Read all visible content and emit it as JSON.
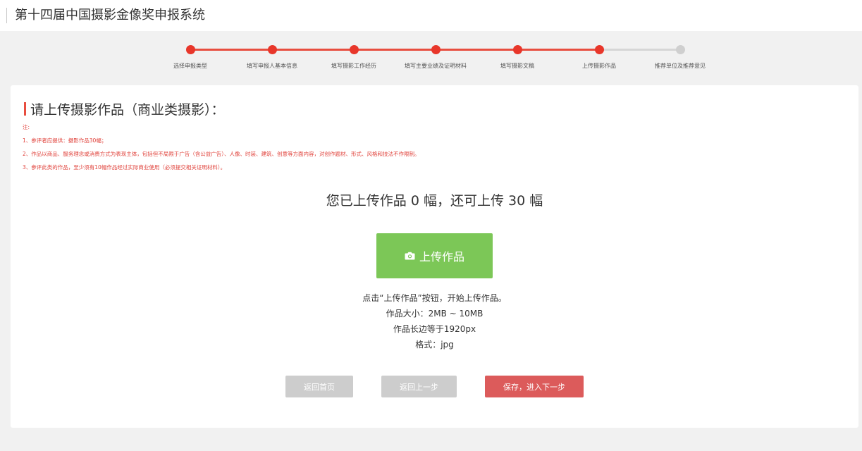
{
  "header": {
    "title": "第十四届中国摄影金像奖申报系统"
  },
  "stepper": {
    "steps": [
      {
        "label": "选择申报类型",
        "status": "done"
      },
      {
        "label": "填写申报人基本信息",
        "status": "done"
      },
      {
        "label": "填写摄影工作经历",
        "status": "done"
      },
      {
        "label": "填写主要业绩及证明材料",
        "status": "done"
      },
      {
        "label": "填写摄影文稿",
        "status": "done"
      },
      {
        "label": "上传摄影作品",
        "status": "current"
      },
      {
        "label": "推荐单位及推荐意见",
        "status": "todo"
      }
    ],
    "colors": {
      "active": "#e8362a",
      "inactive": "#cfcfcf"
    }
  },
  "main": {
    "title": "请上传摄影作品（商业类摄影）：",
    "notes": [
      "注:",
      "1、参评者应提供：摄影作品30幅；",
      "2、作品以商品、服务理念或消费方式为表现主体，包括但不局限于广告（含公益广告）、人像、时装、建筑、创意等方面内容，对创作题材、形式、风格和技法不作限制。",
      "3、参评此类的作品，至少须有10幅作品经过实际商业使用（必须提交相关证明材料）。"
    ],
    "upload_status": "您已上传作品 0 幅，还可上传 30 幅",
    "upload_button": {
      "label": "上传作品",
      "icon": "camera-icon",
      "color": "#7cc757"
    },
    "info": [
      "点击“上传作品”按钮，开始上传作品。",
      "作品大小：2MB ~ 10MB",
      "作品长边等于1920px",
      "格式：jpg"
    ]
  },
  "actions": {
    "home": "返回首页",
    "prev": "返回上一步",
    "next": "保存，进入下一步",
    "next_color": "#dc5b5b"
  }
}
